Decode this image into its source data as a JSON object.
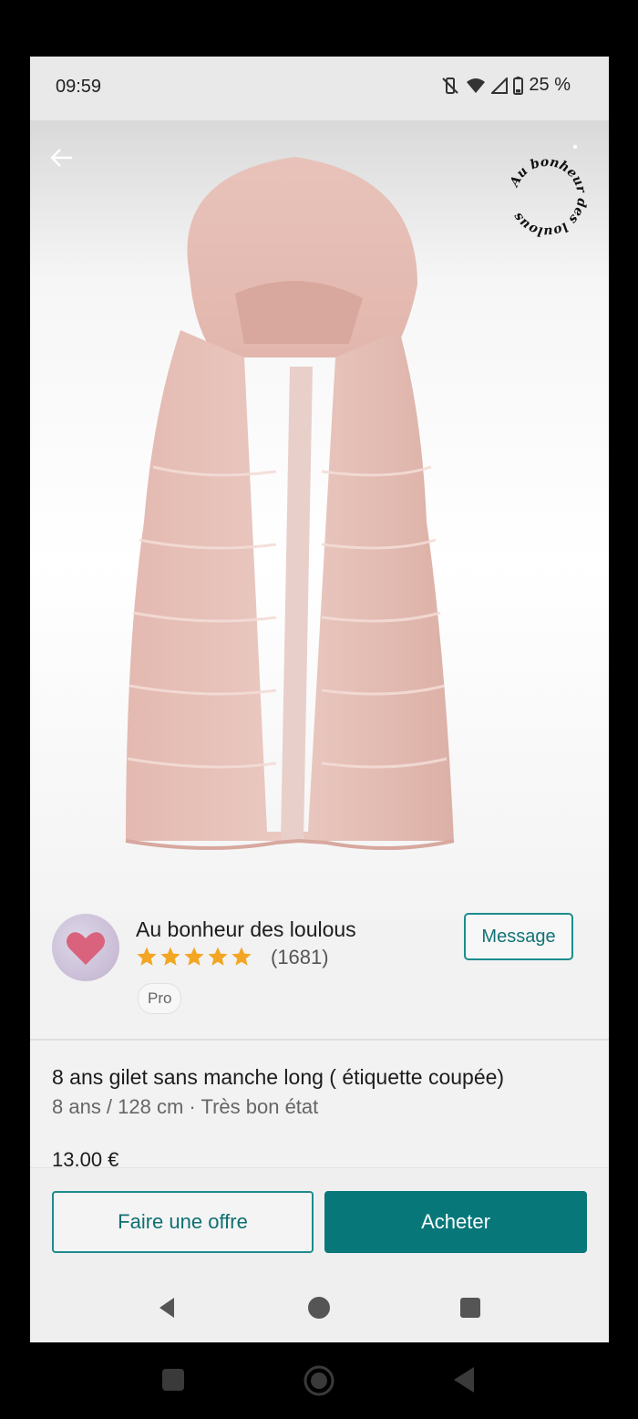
{
  "status_bar": {
    "time": "09:59",
    "battery": "25 %",
    "icons": [
      "mute-vibrate-icon",
      "wifi-icon",
      "signal-icon",
      "battery-icon"
    ]
  },
  "hero": {
    "watermark_text": "Au bonheur des loulous",
    "image_subject": "pink faux-fur hooded vest"
  },
  "seller": {
    "name": "Au bonheur des loulous",
    "rating_count": "(1681)",
    "stars": 5,
    "badge": "Pro",
    "message_label": "Message"
  },
  "item": {
    "title": "8 ans gilet sans manche long ( étiquette coupée)",
    "subtitle": "8 ans / 128 cm · Très bon état",
    "price": "13.00 €"
  },
  "actions": {
    "offer_label": "Faire une offre",
    "buy_label": "Acheter"
  },
  "colors": {
    "accent": "#08777a",
    "star": "#f2a623",
    "background": "#f2f2f2"
  }
}
